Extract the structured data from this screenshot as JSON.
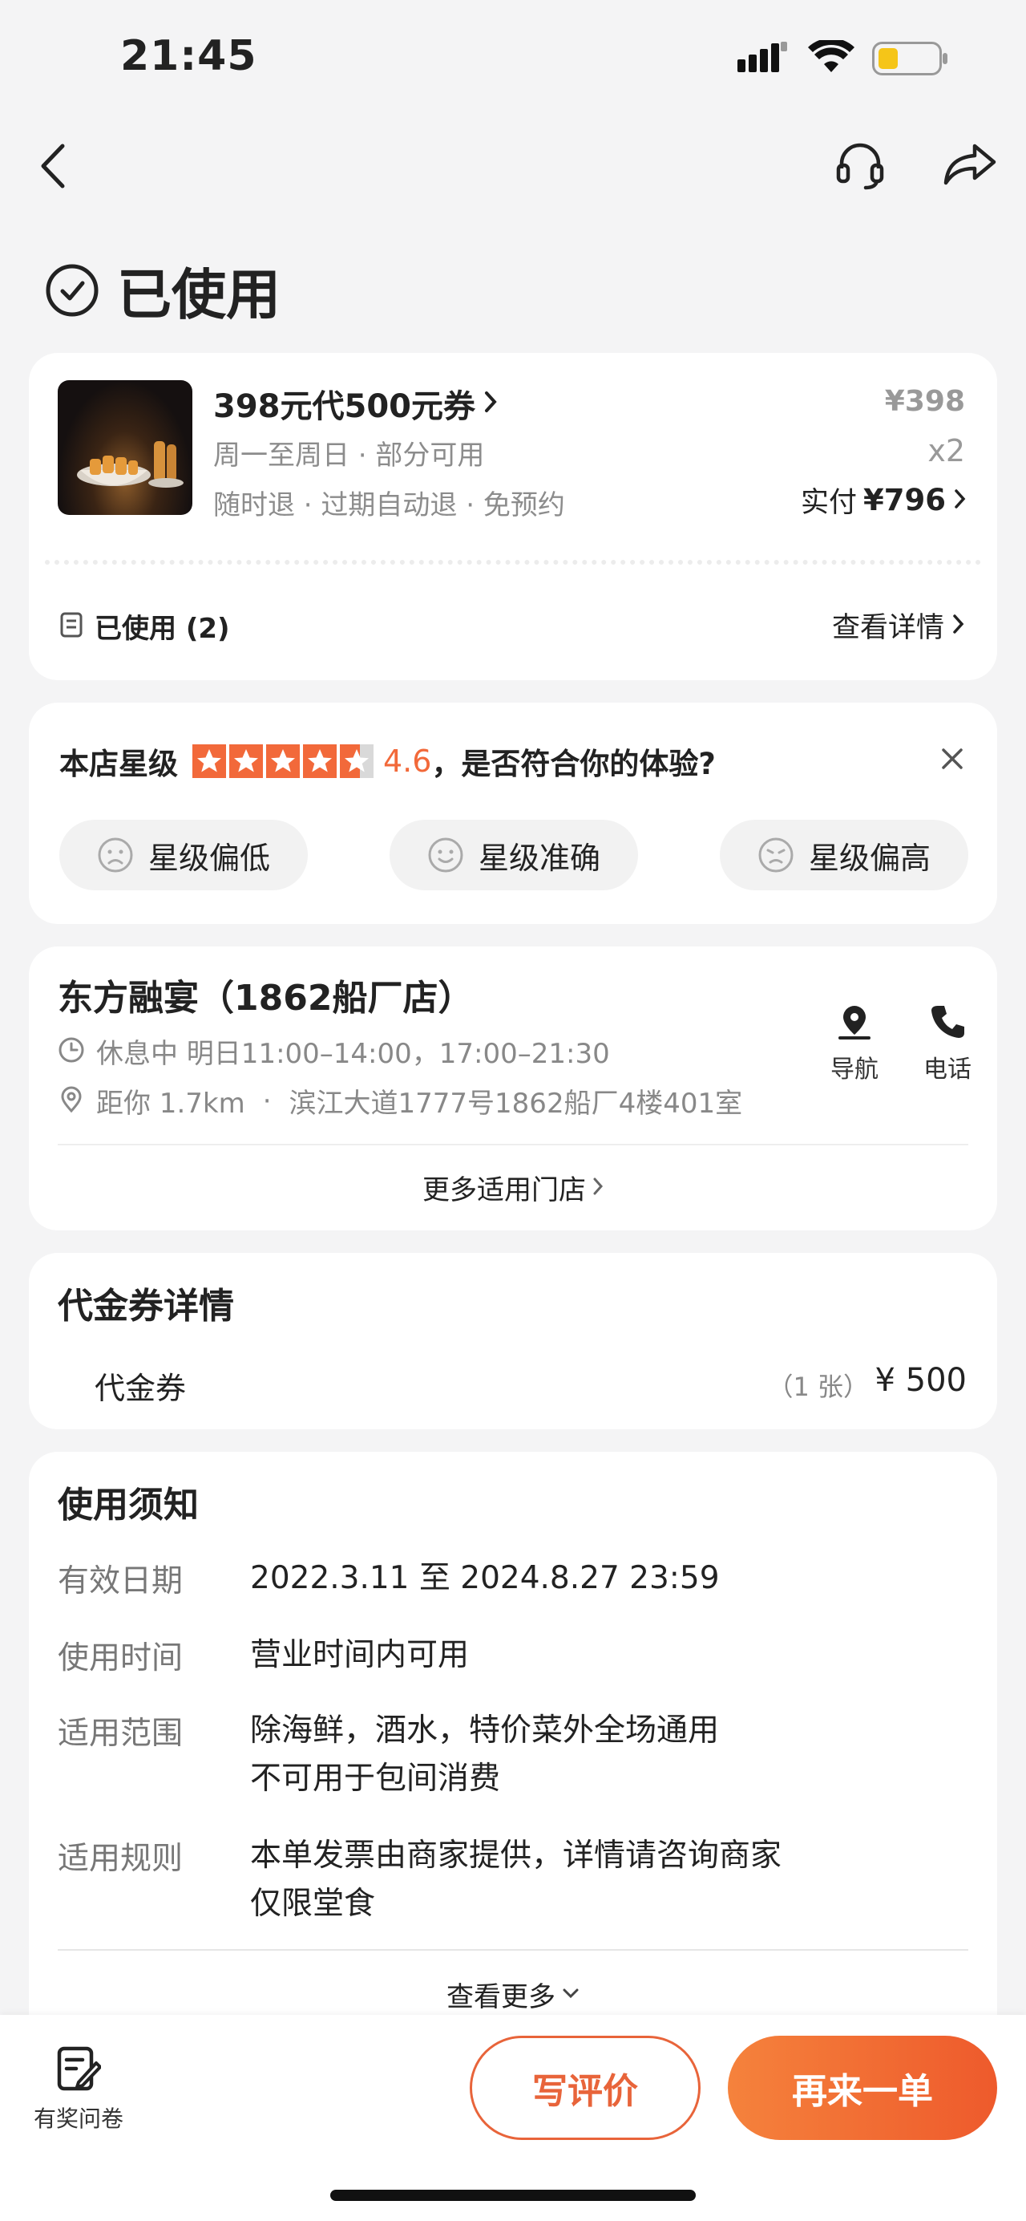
{
  "status_bar": {
    "time": "21:45"
  },
  "header": {
    "status_title": "已使用"
  },
  "order": {
    "title": "398元代500元券",
    "days": "周一至周日 · 部分可用",
    "policy": "随时退 · 过期自动退 · 免预约",
    "unit_price": "¥398",
    "quantity": "x2",
    "paid_label": "实付",
    "paid_amount": "¥796",
    "used_label": "已使用 (2)",
    "detail_link": "查看详情"
  },
  "rating": {
    "prefix": "本店星级",
    "score": "4.6",
    "question": "，是否符合你的体验?",
    "stars": 4.6,
    "options": [
      "星级偏低",
      "星级准确",
      "星级偏高"
    ]
  },
  "shop": {
    "name": "东方融宴（1862船厂店）",
    "hours": "休息中 明日11:00–14:00，17:00–21:30",
    "distance": "距你 1.7km",
    "address": "滨江大道1777号1862船厂4楼401室",
    "nav_label": "导航",
    "phone_label": "电话",
    "more_stores": "更多适用门店"
  },
  "voucher": {
    "heading": "代金券详情",
    "name": "代金券",
    "count": "（1 张）",
    "value": "¥ 500"
  },
  "notice": {
    "heading": "使用须知",
    "rows": [
      {
        "label": "有效日期",
        "lines": [
          "2022.3.11 至 2024.8.27 23:59"
        ]
      },
      {
        "label": "使用时间",
        "lines": [
          "营业时间内可用"
        ]
      },
      {
        "label": "适用范围",
        "lines": [
          "除海鲜，酒水，特价菜外全场通用",
          "不可用于包间消费"
        ]
      },
      {
        "label": "适用规则",
        "lines": [
          "本单发票由商家提供，详情请咨询商家",
          "仅限堂食"
        ]
      }
    ],
    "more": "查看更多"
  },
  "bottom": {
    "survey": "有奖问卷",
    "review": "写评价",
    "reorder": "再来一单"
  },
  "colors": {
    "accent": "#f2693a",
    "button_gradient_start": "#f5823c",
    "button_gradient_end": "#ee5a2c"
  }
}
